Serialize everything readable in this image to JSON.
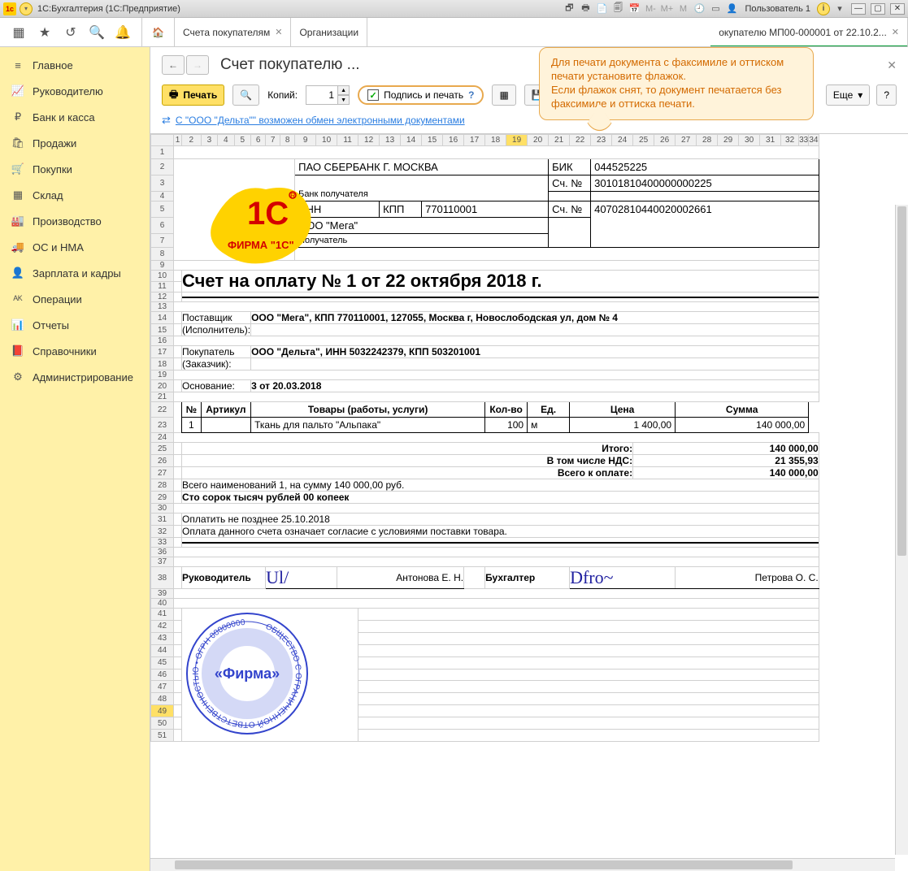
{
  "titlebar": {
    "title": "1С:Бухгалтерия  (1С:Предприятие)",
    "user": "Пользователь 1",
    "m_labels": [
      "M-",
      "M+",
      "M"
    ]
  },
  "tabs": {
    "t1": "Счета покупателям",
    "t2": "Организации",
    "t3": "окупателю МП00-000001 от 22.10.2..."
  },
  "nav": {
    "items": [
      {
        "icon": "≡",
        "label": "Главное"
      },
      {
        "icon": "📈",
        "label": "Руководителю"
      },
      {
        "icon": "₽",
        "label": "Банк и касса"
      },
      {
        "icon": "🛍",
        "label": "Продажи"
      },
      {
        "icon": "🛒",
        "label": "Покупки"
      },
      {
        "icon": "▦",
        "label": "Склад"
      },
      {
        "icon": "🏭",
        "label": "Производство"
      },
      {
        "icon": "🚚",
        "label": "ОС и НМА"
      },
      {
        "icon": "👤",
        "label": "Зарплата и кадры"
      },
      {
        "icon": "ᴬᴷ",
        "label": "Операции"
      },
      {
        "icon": "📊",
        "label": "Отчеты"
      },
      {
        "icon": "📕",
        "label": "Справочники"
      },
      {
        "icon": "⚙",
        "label": "Администрирование"
      }
    ]
  },
  "page": {
    "title": "Счет покупателю ..."
  },
  "toolbar": {
    "print": "Печать",
    "copies_label": "Копий:",
    "copies_value": "1",
    "sig_stamp": "Подпись и печать",
    "more": "Еще",
    "help": "?"
  },
  "linkbar": {
    "text": "С \"ООО \"Дельта\"\" возможен обмен электронными документами"
  },
  "callout": {
    "line1": "Для печати документа с факсимиле и оттиском печати установите флажок.",
    "line2": "Если флажок снят, то документ печатается без факсимиле и оттиска печати."
  },
  "cols": [
    "1",
    "2",
    "3",
    "4",
    "5",
    "6",
    "7",
    "8",
    "9",
    "10",
    "11",
    "12",
    "13",
    "14",
    "15",
    "16",
    "17",
    "18",
    "19",
    "20",
    "21",
    "22",
    "23",
    "24",
    "25",
    "26",
    "27",
    "28",
    "29",
    "30",
    "31",
    "32",
    "33",
    "34"
  ],
  "doc": {
    "bank_name": "ПАО СБЕРБАНК Г. МОСКВА",
    "bank_lbl": "Банк получателя",
    "bik_lbl": "БИК",
    "bik": "044525225",
    "acc_lbl": "Сч. №",
    "acc1": "30101810400000000225",
    "inn_lbl": "ИНН",
    "kpp_lbl": "КПП",
    "inn": "",
    "kpp": "770110001",
    "acc2": "40702810440020002661",
    "payee": "ООО \"Мега\"",
    "payee_lbl": "Получатель",
    "title": "Счет на оплату № 1 от 22 октября 2018 г.",
    "supplier_lbl": "Поставщик",
    "supplier_lbl2": "(Исполнитель):",
    "supplier": "ООО \"Мега\", КПП 770110001, 127055, Москва г, Новослободская ул, дом № 4",
    "buyer_lbl": "Покупатель",
    "buyer_lbl2": "(Заказчик):",
    "buyer": "ООО \"Дельта\", ИНН 5032242379, КПП 503201001",
    "base_lbl": "Основание:",
    "base": "3 от 20.03.2018",
    "th": {
      "n": "№",
      "art": "Артикул",
      "goods": "Товары (работы, услуги)",
      "qty": "Кол-во",
      "unit": "Ед.",
      "price": "Цена",
      "sum": "Сумма"
    },
    "row": {
      "n": "1",
      "art": "",
      "goods": "Ткань для пальто \"Альпака\"",
      "qty": "100",
      "unit": "м",
      "price": "1 400,00",
      "sum": "140 000,00"
    },
    "totals": {
      "itogo_lbl": "Итого:",
      "itogo": "140 000,00",
      "nds_lbl": "В том числе НДС:",
      "nds": "21 355,93",
      "total_lbl": "Всего к оплате:",
      "total": "140 000,00"
    },
    "summary": "Всего наименований 1, на сумму 140 000,00 руб.",
    "words": "Сто сорок тысяч рублей 00 копеек",
    "deadline": "Оплатить не позднее 25.10.2018",
    "terms": "Оплата данного счета означает согласие с условиями поставки товара.",
    "head_lbl": "Руководитель",
    "head_name": "Антонова Е. Н.",
    "acct_lbl": "Бухгалтер",
    "acct_name": "Петрова О. С.",
    "stamp_text": "«Фирма»"
  }
}
